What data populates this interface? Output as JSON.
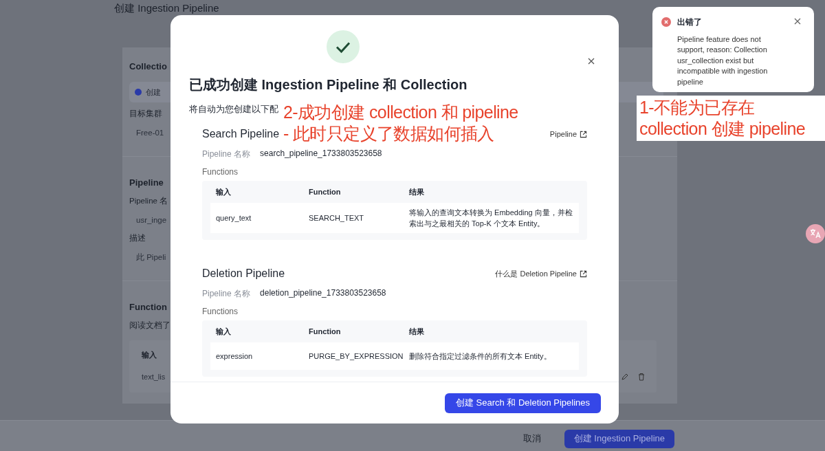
{
  "background_page": {
    "title": "创建 Ingestion Pipeline",
    "fragments": [
      {
        "kind": "heading",
        "text": "Collectio"
      },
      {
        "kind": "notice",
        "text": "创建"
      },
      {
        "kind": "label",
        "text": "目标集群"
      },
      {
        "kind": "value",
        "text": "Free-01"
      },
      {
        "kind": "heading",
        "text": "Pipeline"
      },
      {
        "kind": "label",
        "text": "Pipeline 名"
      },
      {
        "kind": "value",
        "text": "usr_inge"
      },
      {
        "kind": "label",
        "text": "描述"
      },
      {
        "kind": "value",
        "text": "此 Pipeli"
      },
      {
        "kind": "heading",
        "text": "Function"
      },
      {
        "kind": "label",
        "text": "阅读文档了"
      },
      {
        "kind": "table",
        "header": "输入",
        "cell": "text_lis"
      }
    ],
    "footer": {
      "cancel": "取消",
      "submit": "创建 Ingestion Pipeline"
    }
  },
  "modal": {
    "title": "已成功创建 Ingestion Pipeline 和 Collection",
    "subtitle": "将自动为您创建以下配",
    "sections": [
      {
        "title": "Search Pipeline",
        "link": "Pipeline",
        "name_label": "Pipeline 名称",
        "name_value": "search_pipeline_1733803523658",
        "functions_label": "Functions",
        "columns": [
          "输入",
          "Function",
          "结果"
        ],
        "rows": [
          [
            "query_text",
            "SEARCH_TEXT",
            "将输入的查询文本转换为 Embedding 向量，并检索出与之最相关的 Top-K 个文本 Entity。"
          ]
        ]
      },
      {
        "title": "Deletion Pipeline",
        "link": "什么是 Deletion Pipeline",
        "name_label": "Pipeline 名称",
        "name_value": "deletion_pipeline_1733803523658",
        "functions_label": "Functions",
        "columns": [
          "输入",
          "Function",
          "结果"
        ],
        "rows": [
          [
            "expression",
            "PURGE_BY_EXPRESSION",
            "删除符合指定过滤条件的所有文本 Entity。"
          ]
        ]
      }
    ],
    "confirm_button": "创建 Search 和 Deletion Pipelines"
  },
  "toast": {
    "title": "出错了",
    "message": "Pipeline feature does not support, reason: Collection usr_collection exist but incompatible with ingestion pipeline"
  },
  "annotations": [
    {
      "lines": [
        "2-成功创建 collection 和 pipeline",
        "- 此时只定义了数据如何插入"
      ]
    },
    {
      "lines": [
        "1-不能为已存在",
        "collection 创建 pipeline"
      ]
    }
  ]
}
